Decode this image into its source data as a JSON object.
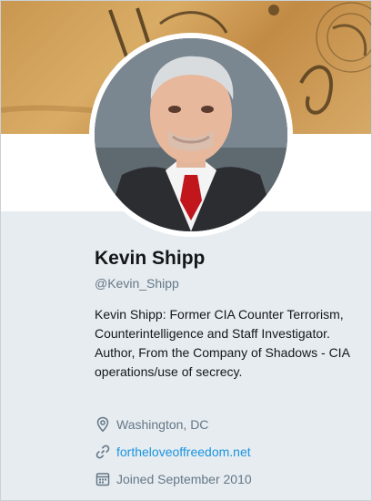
{
  "profile": {
    "name": "Kevin Shipp",
    "handle": "@Kevin_Shipp",
    "bio": "Kevin Shipp: Former CIA Counter Terrorism, Counterintelligence and Staff Investigator. Author, From the Company of Shadows - CIA operations/use of secrecy.",
    "location": "Washington, DC",
    "url": "fortheloveoffreedom.net",
    "joined": "Joined September 2010"
  },
  "icons": {
    "location": "location-pin-icon",
    "url": "link-icon",
    "joined": "calendar-icon"
  },
  "colors": {
    "link": "#1b95e0",
    "secondary_text": "#657786",
    "card_bg": "#e6ecf0"
  }
}
